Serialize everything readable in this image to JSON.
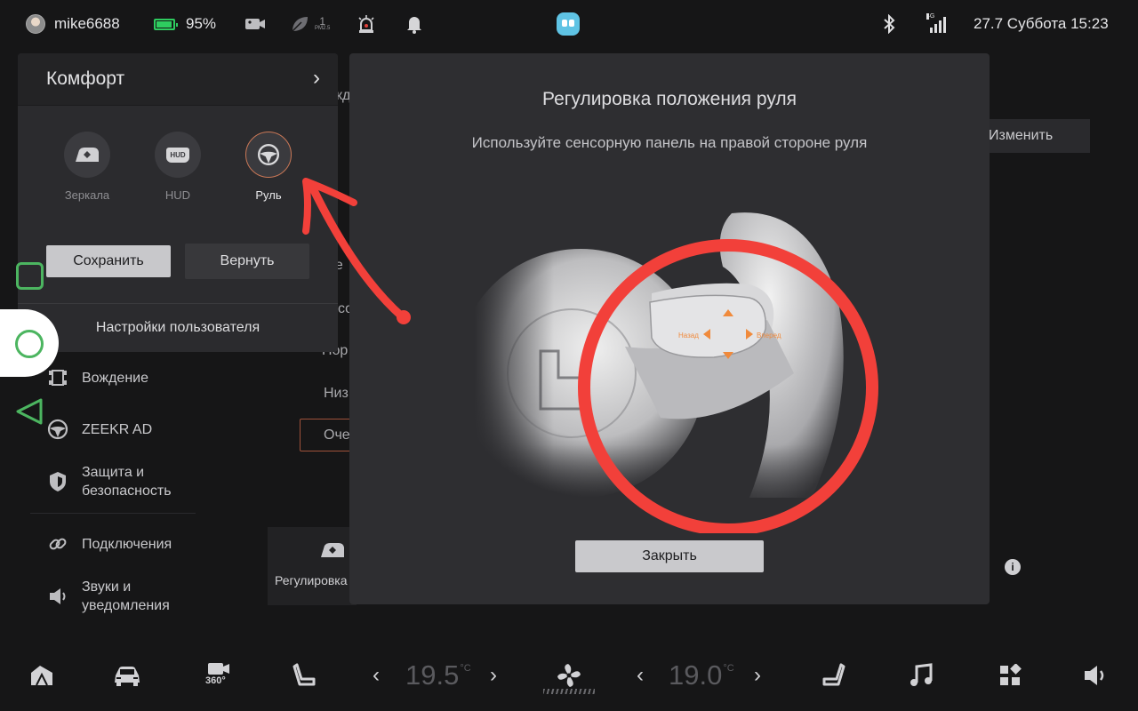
{
  "status_bar": {
    "username": "mike6688",
    "battery_percent": "95%",
    "pm_value": "1",
    "pm_label": "PM2.5",
    "network": "4G",
    "datetime": "27.7 Суббота 15:23",
    "battery_color": "#2ecc5f"
  },
  "left_nav": {
    "items": [
      {
        "label": "Вождение",
        "icon": "car-frame-icon"
      },
      {
        "label": "ZEEKR AD",
        "icon": "steering-wheel-icon"
      },
      {
        "label": "Защита и\nбезопасность",
        "line1": "Защита и",
        "line2": "безопасность",
        "icon": "shield-icon"
      },
      {
        "label": "Подключения",
        "icon": "link-icon"
      },
      {
        "label": "Звуки и уведомления",
        "line1": "Звуки и",
        "line2": "уведомления",
        "icon": "speaker-icon"
      }
    ]
  },
  "background": {
    "frag_top": "кд",
    "change_button": "Изменить",
    "frag_rows": [
      "не",
      "со",
      "Пор",
      "Низ"
    ],
    "ochi_button": "Оче",
    "card_label": "Регулировка"
  },
  "comfort_panel": {
    "title": "Комфорт",
    "adjustments": [
      {
        "label": "Зеркала",
        "icon": "mirror-icon",
        "selected": false
      },
      {
        "label": "HUD",
        "icon": "hud-icon",
        "badge": "HUD",
        "selected": false
      },
      {
        "label": "Руль",
        "icon": "steering-wheel-icon",
        "selected": true
      }
    ],
    "save_button": "Сохранить",
    "revert_button": "Вернуть",
    "user_settings": "Настройки пользователя"
  },
  "modal": {
    "title": "Регулировка положения руля",
    "subtitle": "Используйте сенсорную панель на правой стороне руля",
    "panel_labels": {
      "left": "Назад",
      "right": "Вперед"
    },
    "close_button": "Закрыть",
    "highlight_color": "#f2403a",
    "accent_color": "#f08a3c"
  },
  "dock": {
    "left_temp": "19.5",
    "right_temp": "19.0",
    "temp_unit": "°C",
    "cam_label": "360°"
  }
}
